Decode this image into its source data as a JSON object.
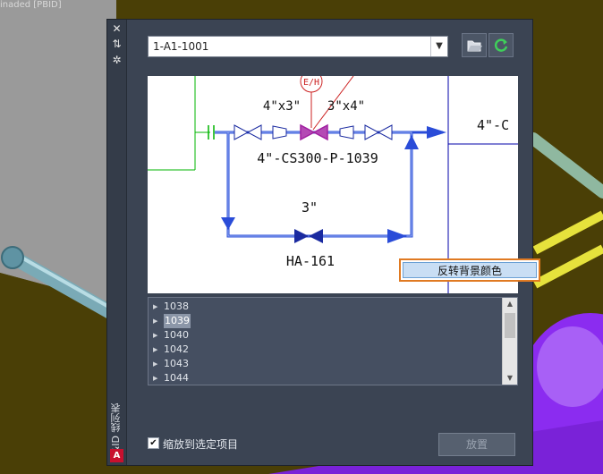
{
  "background": {
    "top_text": "inaded [PBID]",
    "colors": {
      "ground": "#4a3f06",
      "pipe": "#8fbcc8",
      "yellow_pipe": "#e6e23c",
      "vessel": "#8b2cf0"
    }
  },
  "palette": {
    "side_strip": {
      "title": "P&ID 线列表",
      "logo_text": "A",
      "icons": [
        "close-icon",
        "pin-icon",
        "settings-icon"
      ]
    },
    "drawing_selector": {
      "value": "1-A1-1001"
    },
    "toolbar": {
      "icons": [
        "folder-open-icon",
        "refresh-icon"
      ]
    },
    "preview": {
      "labels": {
        "tag": "E/H",
        "reducer_left": "4\"x3\"",
        "reducer_right": "3\"x4\"",
        "main_line": "4\"-CS300-P-1039",
        "offpage_line": "4\"-C",
        "loop_size": "3\"",
        "valve_tag": "HA-161"
      },
      "context_menu": {
        "item": "反转背景颜色"
      }
    },
    "line_list": {
      "items": [
        {
          "label": "1038",
          "selected": false
        },
        {
          "label": "1039",
          "selected": true
        },
        {
          "label": "1040",
          "selected": false
        },
        {
          "label": "1042",
          "selected": false
        },
        {
          "label": "1043",
          "selected": false
        },
        {
          "label": "1044",
          "selected": false
        }
      ]
    },
    "zoom_checkbox": {
      "label": "缩放到选定项目",
      "checked": true
    },
    "place_button": {
      "label": "放置"
    }
  }
}
